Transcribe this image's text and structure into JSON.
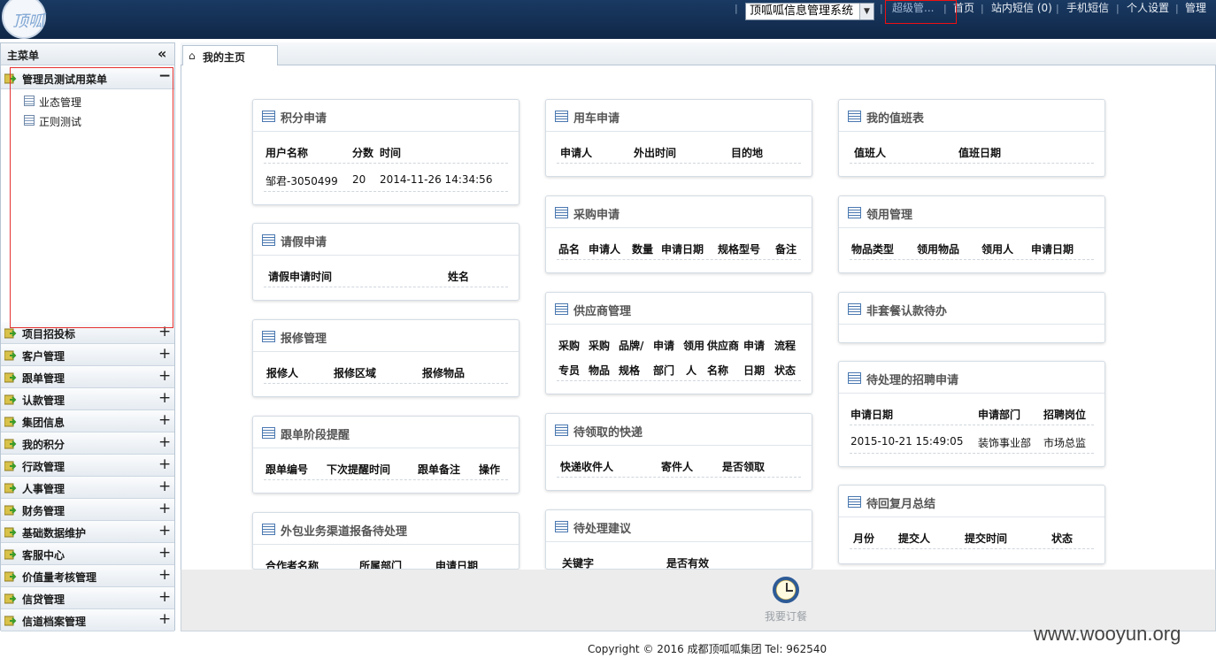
{
  "header": {
    "logo_text": "顶呱",
    "system_select": "顶呱呱信息管理系统",
    "links": [
      "超级管...",
      "首页",
      "站内短信 (0)",
      "手机短信",
      "个人设置",
      "管理"
    ]
  },
  "sidebar": {
    "title": "主菜单",
    "expanded_group": "管理员测试用菜单",
    "sub_items": [
      "业态管理",
      "正则测试"
    ],
    "groups": [
      "项目招投标",
      "客户管理",
      "跟单管理",
      "认款管理",
      "集团信息",
      "我的积分",
      "行政管理",
      "人事管理",
      "财务管理",
      "基础数据维护",
      "客服中心",
      "价值量考核管理",
      "信贷管理",
      "信道档案管理"
    ]
  },
  "tabs": {
    "home": "我的主页"
  },
  "panels": {
    "jifen": {
      "title": "积分申请",
      "headers": [
        "用户名称",
        "分数",
        "时间"
      ],
      "rows": [
        [
          "邹君-3050499",
          "20",
          "2014-11-26 14:34:56"
        ]
      ]
    },
    "qingjia": {
      "title": "请假申请",
      "headers": [
        "请假申请时间",
        "姓名"
      ]
    },
    "baoxiu": {
      "title": "报修管理",
      "headers": [
        "报修人",
        "报修区域",
        "报修物品"
      ]
    },
    "gendan": {
      "title": "跟单阶段提醒",
      "headers": [
        "跟单编号",
        "下次提醒时间",
        "跟单备注",
        "操作"
      ]
    },
    "waibao": {
      "title": "外包业务渠道报备待处理",
      "headers": [
        "合作者名称",
        "所属部门",
        "申请日期"
      ]
    },
    "yongche": {
      "title": "用车申请",
      "headers": [
        "申请人",
        "外出时间",
        "目的地"
      ]
    },
    "caigou": {
      "title": "采购申请",
      "headers": [
        "品名",
        "申请人",
        "数量",
        "申请日期",
        "规格型号",
        "备注"
      ]
    },
    "gongying": {
      "title": "供应商管理",
      "headers_line1": [
        "采购",
        "采购",
        "品牌/",
        "申请",
        "领用",
        "供应商",
        "申请",
        "流程"
      ],
      "headers_line2": [
        "专员",
        "物品",
        "规格",
        "部门",
        "人",
        "名称",
        "日期",
        "状态"
      ]
    },
    "kuaidi": {
      "title": "待领取的快递",
      "headers": [
        "快递收件人",
        "寄件人",
        "是否领取"
      ]
    },
    "jianyi": {
      "title": "待处理建议",
      "headers": [
        "关键字",
        "是否有效"
      ]
    },
    "zhiban": {
      "title": "我的值班表",
      "headers": [
        "值班人",
        "值班日期"
      ]
    },
    "lingyong": {
      "title": "领用管理",
      "headers": [
        "物品类型",
        "领用物品",
        "领用人",
        "申请日期"
      ]
    },
    "feitaocan": {
      "title": "非套餐认款待办"
    },
    "zhaopin": {
      "title": "待处理的招聘申请",
      "headers": [
        "申请日期",
        "申请部门",
        "招聘岗位"
      ],
      "rows": [
        [
          "2015-10-21 15:49:05",
          "装饰事业部",
          "市场总监"
        ]
      ]
    },
    "fuyue": {
      "title": "待回复月总结",
      "headers": [
        "月份",
        "提交人",
        "提交时间",
        "状态"
      ]
    }
  },
  "bottom": {
    "order_label": "我要订餐"
  },
  "footer": {
    "copyright": "Copyright © 2016 成都顶呱呱集团 Tel: 962540"
  },
  "watermark": "www.wooyun.org",
  "colors": {
    "header_bg": "#0f2747",
    "highlight_border": "#e53030",
    "panel_title": "#555555"
  }
}
